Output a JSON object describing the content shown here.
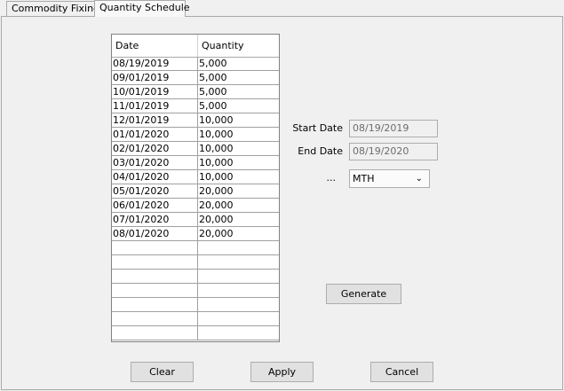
{
  "tabs": [
    {
      "label": "Commodity Fixings"
    },
    {
      "label": "Quantity Schedule"
    }
  ],
  "schedule": {
    "columns": [
      "Date",
      "Quantity"
    ],
    "rows": [
      [
        "08/19/2019",
        "5,000"
      ],
      [
        "09/01/2019",
        "5,000"
      ],
      [
        "10/01/2019",
        "5,000"
      ],
      [
        "11/01/2019",
        "5,000"
      ],
      [
        "12/01/2019",
        "10,000"
      ],
      [
        "01/01/2020",
        "10,000"
      ],
      [
        "02/01/2020",
        "10,000"
      ],
      [
        "03/01/2020",
        "10,000"
      ],
      [
        "04/01/2020",
        "10,000"
      ],
      [
        "05/01/2020",
        "20,000"
      ],
      [
        "06/01/2020",
        "20,000"
      ],
      [
        "07/01/2020",
        "20,000"
      ],
      [
        "08/01/2020",
        "20,000"
      ],
      [
        "",
        ""
      ],
      [
        "",
        ""
      ],
      [
        "",
        ""
      ],
      [
        "",
        ""
      ],
      [
        "",
        ""
      ],
      [
        "",
        ""
      ],
      [
        "",
        ""
      ]
    ]
  },
  "form": {
    "start_date_label": "Start Date",
    "start_date_value": "08/19/2019",
    "end_date_label": "End Date",
    "end_date_value": "08/19/2020",
    "frequency_label": "...",
    "frequency_value": "MTH",
    "frequency_arrow": "⌄"
  },
  "buttons": {
    "generate": "Generate",
    "clear": "Clear",
    "apply": "Apply",
    "cancel": "Cancel"
  }
}
